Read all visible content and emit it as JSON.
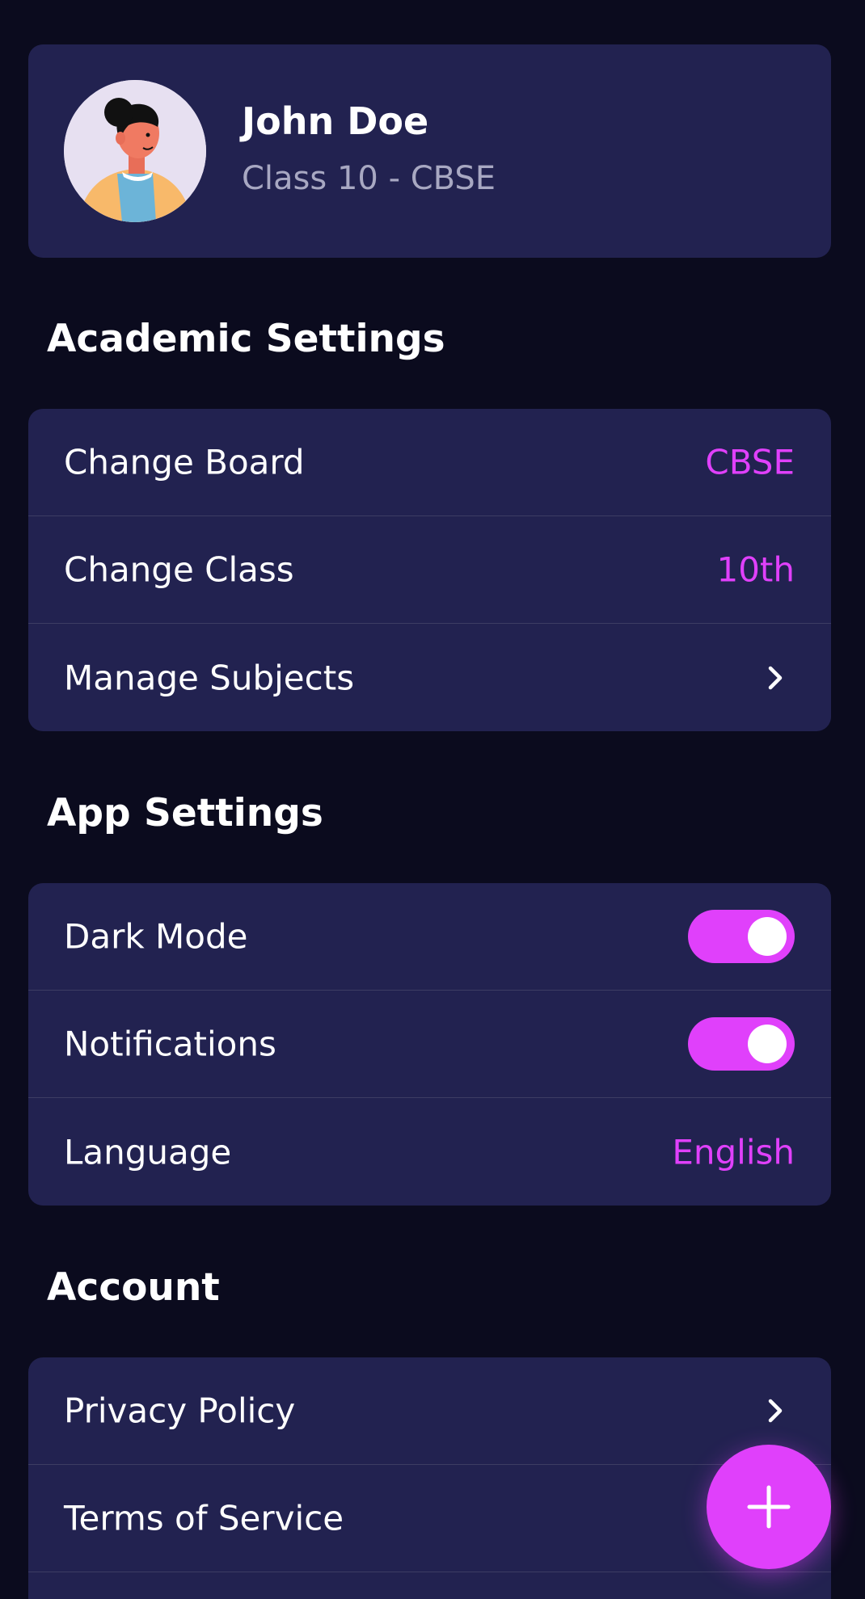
{
  "profile": {
    "name": "John Doe",
    "subtitle": "Class 10 - CBSE",
    "avatar_icon": "user-avatar-illustration"
  },
  "academic": {
    "title": "Academic Settings",
    "items": [
      {
        "label": "Change Board",
        "value": "CBSE"
      },
      {
        "label": "Change Class",
        "value": "10th"
      },
      {
        "label": "Manage Subjects",
        "icon": "chevron-right-icon"
      }
    ]
  },
  "app": {
    "title": "App Settings",
    "items": [
      {
        "label": "Dark Mode",
        "toggle": true
      },
      {
        "label": "Notifications",
        "toggle": true
      },
      {
        "label": "Language",
        "value": "English"
      }
    ]
  },
  "account": {
    "title": "Account",
    "items": [
      {
        "label": "Privacy Policy",
        "icon": "chevron-right-icon"
      },
      {
        "label": "Terms of Service",
        "icon": "chevron-right-icon"
      }
    ]
  },
  "fab": {
    "icon": "plus-icon"
  },
  "colors": {
    "background": "#0b0b1e",
    "card": "#222250",
    "accent": "#e040fb",
    "muted_text": "#a8a8c2",
    "divider": "#3d3d63"
  }
}
